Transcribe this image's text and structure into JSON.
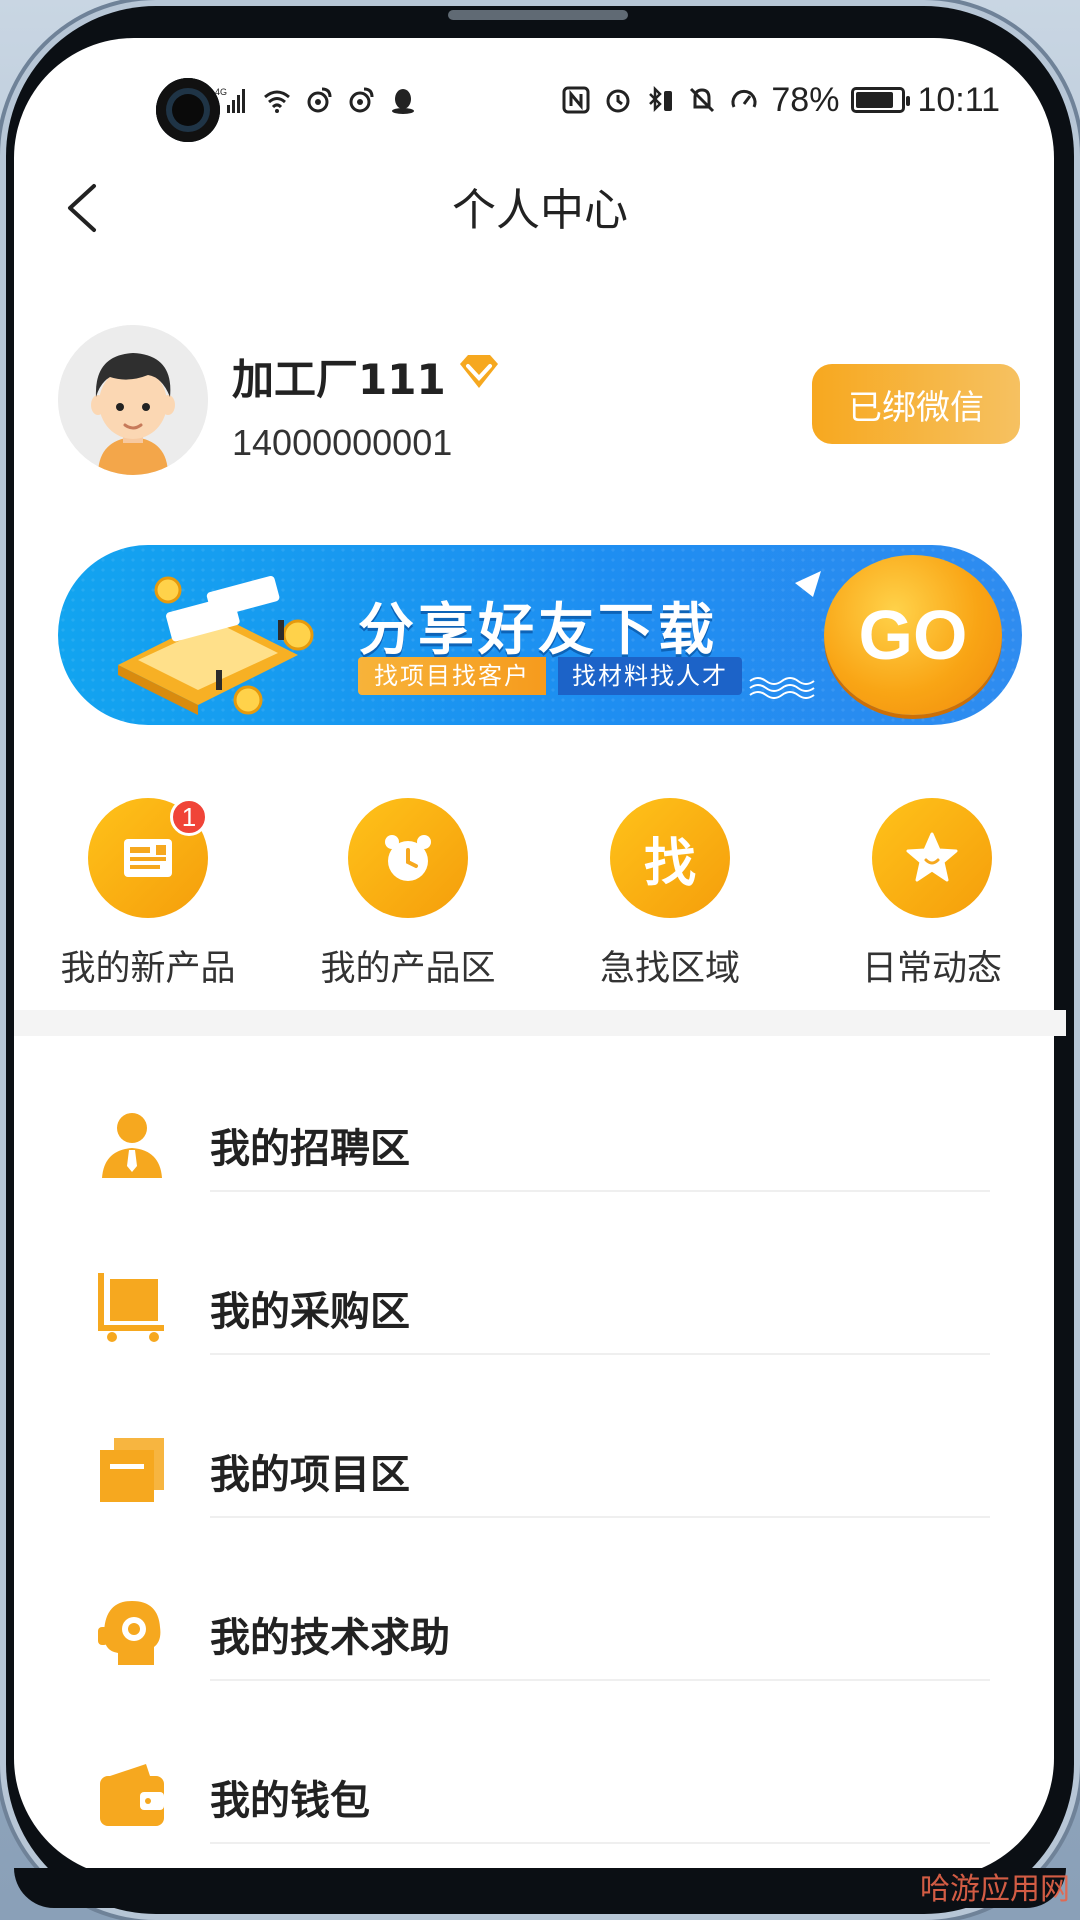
{
  "status_bar": {
    "network": "4G",
    "battery_percent": "78%",
    "time": "10:11"
  },
  "header": {
    "title": "个人中心"
  },
  "profile": {
    "name": "加工厂111",
    "phone": "14000000001",
    "wechat_button": "已绑微信"
  },
  "banner": {
    "title": "分享好友下载",
    "tag1": "找项目找客户",
    "tag2": "找材料找人才",
    "go": "GO"
  },
  "quick_actions": [
    {
      "label": "我的新产品",
      "badge": "1",
      "icon": "newspaper-icon"
    },
    {
      "label": "我的产品区",
      "icon": "alarm-clock-icon"
    },
    {
      "label": "急找区域",
      "icon": "find-icon",
      "glyph": "找"
    },
    {
      "label": "日常动态",
      "icon": "star-icon"
    }
  ],
  "menu": [
    {
      "label": "我的招聘区",
      "icon": "person-tie-icon"
    },
    {
      "label": "我的采购区",
      "icon": "cart-icon"
    },
    {
      "label": "我的项目区",
      "icon": "folders-icon"
    },
    {
      "label": "我的技术求助",
      "icon": "support-head-icon"
    },
    {
      "label": "我的钱包",
      "icon": "wallet-icon"
    }
  ],
  "watermark": "哈游应用网",
  "colors": {
    "accent": "#f59e0b",
    "banner_blue": "#1f8df1",
    "badge_red": "#f04438"
  }
}
